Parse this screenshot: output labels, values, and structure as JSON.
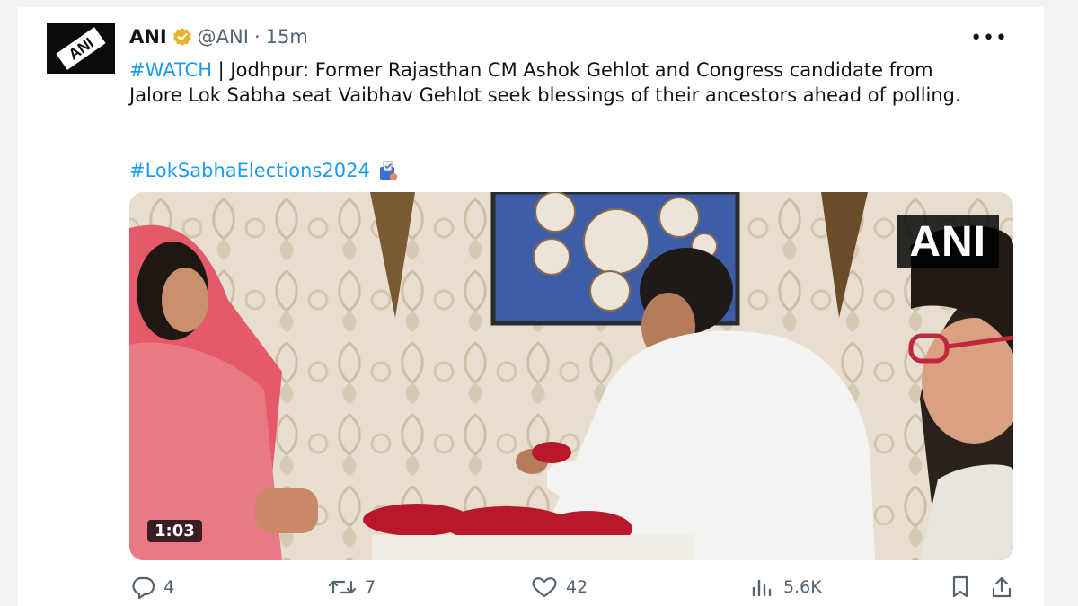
{
  "tweet": {
    "author_name": "ANI",
    "handle": "@ANI",
    "separator": "·",
    "time": "15m",
    "more_label": "•••",
    "avatar_text": "ANI",
    "text_hashtag": "#WATCH",
    "text_body": " | Jodhpur: Former Rajasthan CM Ashok Gehlot and Congress candidate from Jalore Lok Sabha seat Vaibhav Gehlot seek blessings of their ancestors ahead of polling.",
    "hashtag2": "#LokSabhaElections2024"
  },
  "media": {
    "duration": "1:03",
    "watermark": "ANI"
  },
  "actions": {
    "replies": "4",
    "reposts": "7",
    "likes": "42",
    "views": "5.6K"
  },
  "icons": {
    "verified": "verified-badge-icon",
    "ballot": "ballot-box-icon",
    "reply": "reply-icon",
    "repost": "repost-icon",
    "like": "heart-icon",
    "views": "views-icon",
    "bookmark": "bookmark-icon",
    "share": "share-icon"
  },
  "colors": {
    "link": "#1d9bf0",
    "muted": "#536471",
    "verified_gold": "#e8b22e"
  }
}
